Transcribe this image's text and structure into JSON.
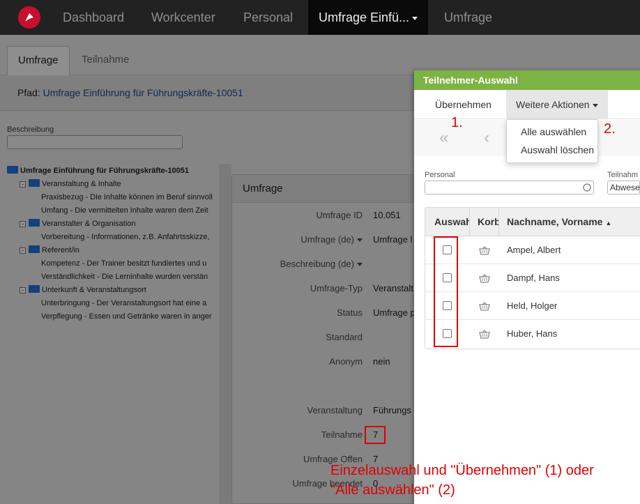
{
  "nav": {
    "items": [
      "Dashboard",
      "Workcenter",
      "Personal",
      "Umfrage Einfü...",
      "Umfrage"
    ],
    "active_index": 3
  },
  "tabs": [
    "Umfrage",
    "Teilnahme"
  ],
  "path": {
    "label": "Pfad:",
    "link": "Umfrage Einführung für Führungskräfte-10051"
  },
  "description_label": "Beschreibung",
  "tree": {
    "root": "Umfrage Einführung für Führungskräfte-10051",
    "groups": [
      {
        "label": "Veranstaltung & Inhalte",
        "items": [
          "Praxisbezug - Die Inhalte können im Beruf sinnvoll",
          "Umfang - Die vermittelten Inhalte waren dem Zeit"
        ]
      },
      {
        "label": "Veranstalter & Organisation",
        "items": [
          "Vorbereitung - Informationen, z.B. Anfahrtsskizze,"
        ]
      },
      {
        "label": "Referent/in",
        "items": [
          "Kompetenz - Der Trainer besitzt fundiertes und u",
          "Verständlichkeit - Die Lerninhalte wurden verstän"
        ]
      },
      {
        "label": "Unterkunft & Veranstaltungsort",
        "items": [
          "Unterbringung - Der Veranstaltungsort hat eine a",
          "Verpflegung - Essen und Getränke waren in anger"
        ]
      }
    ]
  },
  "panel": {
    "title": "Umfrage",
    "fields": [
      {
        "label": "Umfrage ID",
        "value": "10.051"
      },
      {
        "label": "Umfrage (de)",
        "value": "Umfrage l",
        "dropdown": true
      },
      {
        "label": "Beschreibung (de)",
        "value": "",
        "dropdown": true
      },
      {
        "label": "Umfrage-Typ",
        "value": "Veranstalt"
      },
      {
        "label": "Status",
        "value": "Umfrage p"
      },
      {
        "label": "Standard",
        "value": ""
      },
      {
        "label": "Anonym",
        "value": "nein"
      },
      {
        "label": "Veranstaltung",
        "value": "Führungs"
      },
      {
        "label": "Teilnahme",
        "value": "7"
      },
      {
        "label": "Umfrage Offen",
        "value": "7"
      },
      {
        "label": "Umfrage beendet",
        "value": "0"
      }
    ]
  },
  "modal": {
    "title": "Teilnehmer-Auswahl",
    "toolbar": {
      "apply": "Übernehmen",
      "more": "Weitere Aktionen"
    },
    "dropdown": [
      "Alle auswählen",
      "Auswahl löschen"
    ],
    "filters": {
      "personal_label": "Personal",
      "teilnahme_label": "Teilnahm",
      "teilnahme_value": "Abwese"
    },
    "columns": [
      "Auswahl",
      "Korb",
      "Nachname, Vorname"
    ],
    "rows": [
      "Ampel, Albert",
      "Dampf, Hans",
      "Held, Holger",
      "Huber, Hans"
    ]
  },
  "annotations": {
    "step1": "1.",
    "step2": "2.",
    "instruction_line1": "Einzelauswahl und \"Übernehmen\" (1) oder",
    "instruction_line2": "\"Alle auswählen\" (2)"
  },
  "colors": {
    "accent_green": "#7cb342",
    "highlight_red": "#e00000",
    "nav_bg": "#222222"
  }
}
